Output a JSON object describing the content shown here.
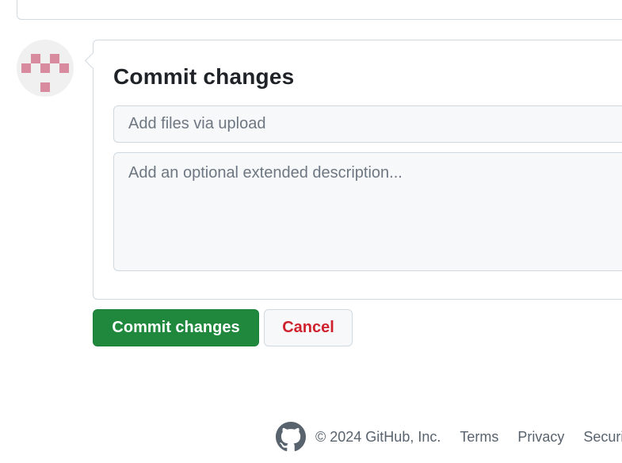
{
  "commit": {
    "title": "Commit changes",
    "summary_placeholder": "Add files via upload",
    "summary_value": "",
    "description_placeholder": "Add an optional extended description...",
    "description_value": ""
  },
  "buttons": {
    "commit_label": "Commit changes",
    "cancel_label": "Cancel"
  },
  "footer": {
    "copyright": "© 2024 GitHub, Inc.",
    "links": [
      "Terms",
      "Privacy",
      "Security"
    ]
  },
  "icons": {
    "avatar": "identicon-avatar",
    "footer_logo": "github-mark-icon"
  },
  "colors": {
    "primary_button": "#1f883d",
    "cancel_text": "#cf222e",
    "identicon": "#d88a9e",
    "input_bg": "#f6f8fa",
    "border": "#d1d9e0"
  }
}
